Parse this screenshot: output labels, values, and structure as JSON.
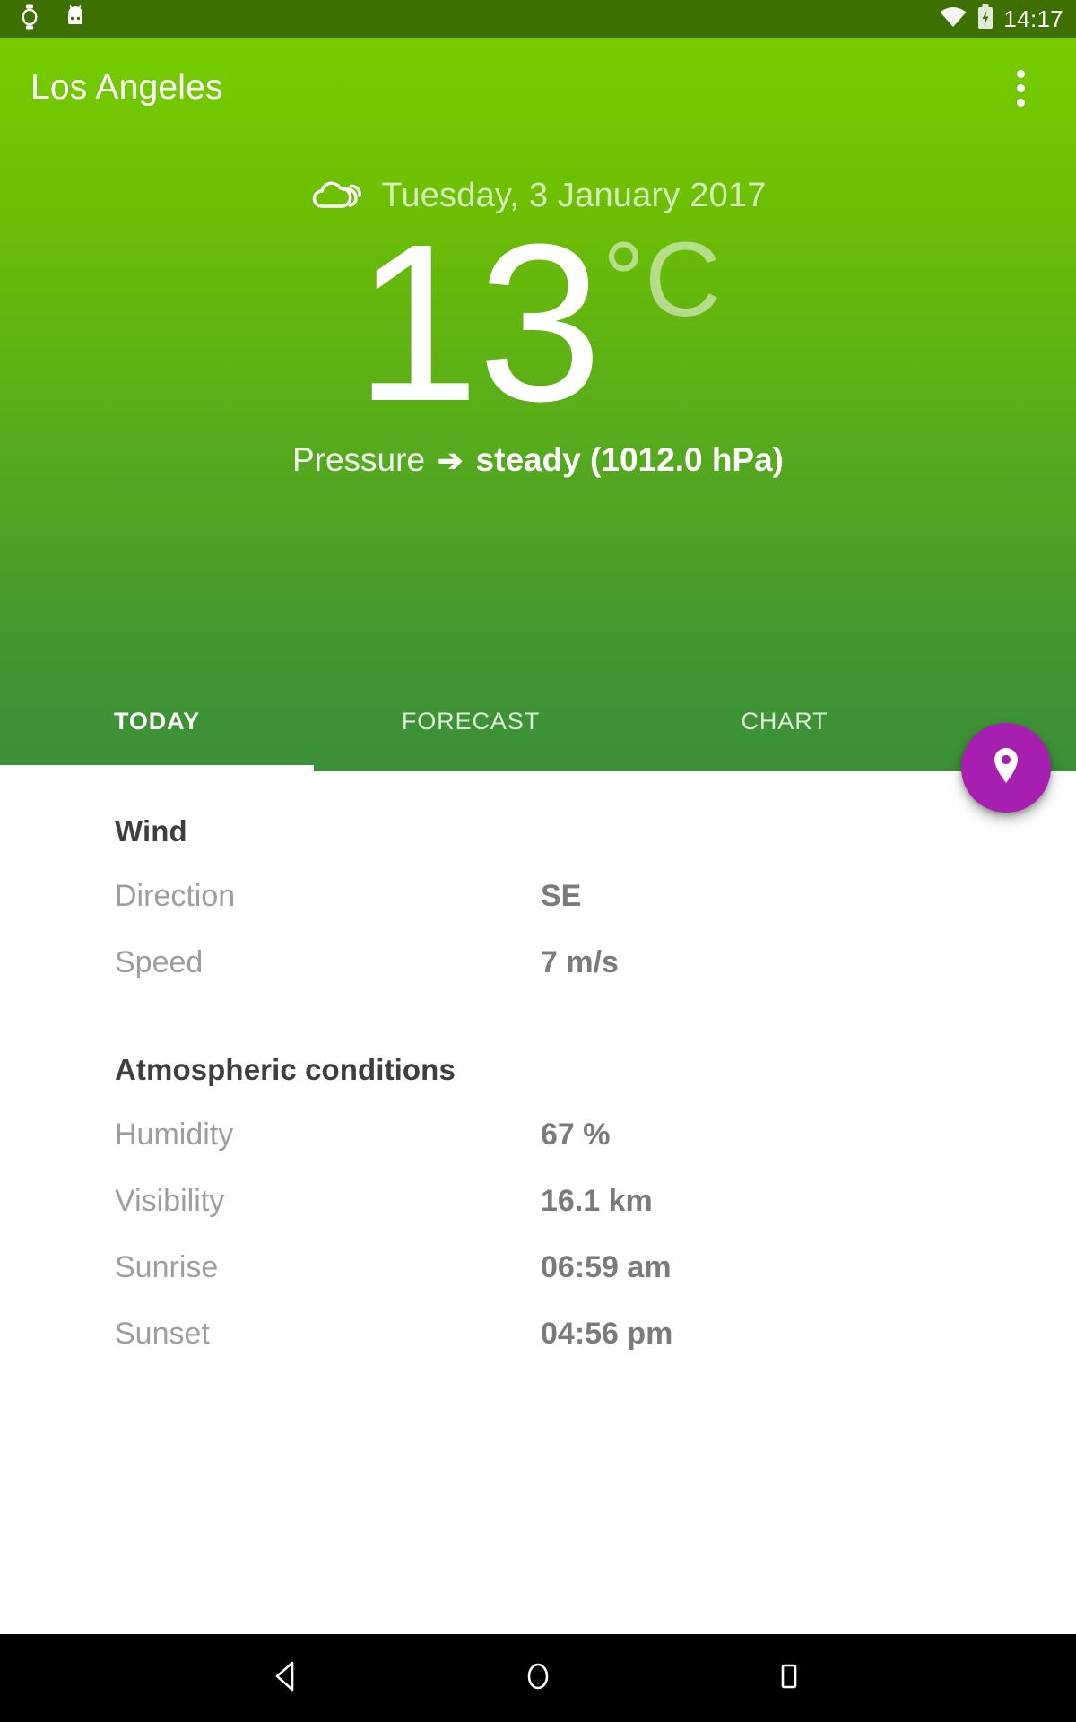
{
  "status_bar": {
    "icons": [
      "watch-icon",
      "android-head-icon"
    ],
    "wifi_icon": "wifi-icon",
    "battery_icon": "battery-charging-icon",
    "time": "14:17",
    "background_color": "#3d7000"
  },
  "app_bar": {
    "title": "Los Angeles",
    "overflow_label": "More options"
  },
  "hero": {
    "condition_icon": "cloudy-icon",
    "date": "Tuesday, 3 January 2017",
    "temperature": "13",
    "unit": "°C",
    "pressure_label": "Pressure",
    "pressure_arrow": "➔",
    "pressure_value": "steady (1012.0 hPa)",
    "gradient_top": "#76cc00",
    "gradient_bottom": "#3b8f38"
  },
  "tabs": {
    "items": [
      {
        "label": "TODAY",
        "active": true
      },
      {
        "label": "FORECAST",
        "active": false
      },
      {
        "label": "CHART",
        "active": false
      }
    ]
  },
  "fab": {
    "icon": "location-pin-icon",
    "color": "#a61fb0"
  },
  "content": {
    "sections": [
      {
        "title": "Wind",
        "rows": [
          {
            "label": "Direction",
            "value": "SE"
          },
          {
            "label": "Speed",
            "value": "7 m/s"
          }
        ]
      },
      {
        "title": "Atmospheric conditions",
        "rows": [
          {
            "label": "Humidity",
            "value": "67 %"
          },
          {
            "label": "Visibility",
            "value": "16.1 km"
          },
          {
            "label": "Sunrise",
            "value": "06:59 am"
          },
          {
            "label": "Sunset",
            "value": "04:56 pm"
          }
        ]
      }
    ]
  },
  "nav_bar": {
    "back_icon": "back-triangle-icon",
    "home_icon": "home-circle-icon",
    "recents_icon": "recents-square-icon"
  }
}
